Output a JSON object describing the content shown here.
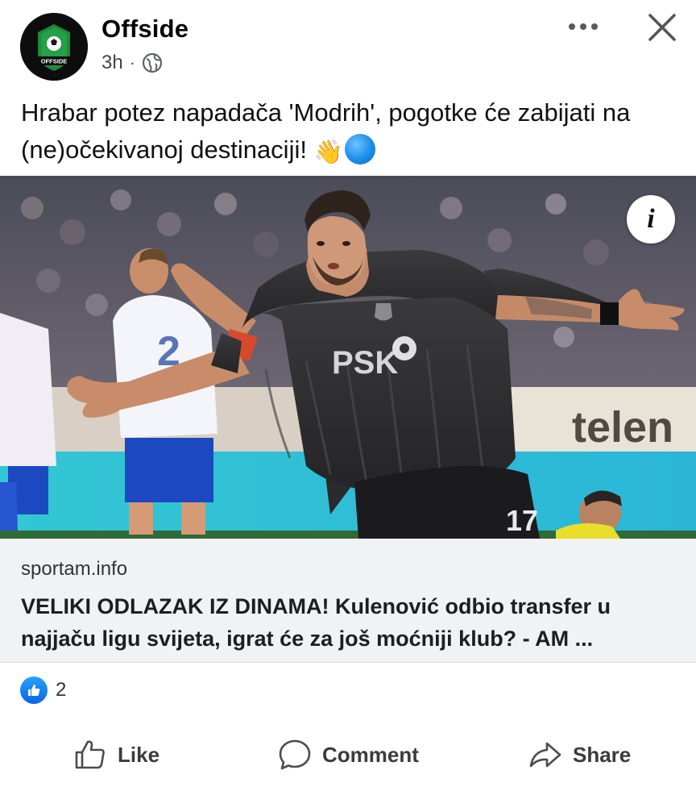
{
  "post": {
    "page_name": "Offside",
    "avatar_logo_text": "OFFSIDE",
    "time": "3h",
    "separator": "·",
    "audience_icon": "globe-icon",
    "caption": "Hrabar potez napadača 'Modrih', pogotke će zabijati na (ne)očekivanoj destinaciji!",
    "caption_emoji": "👋",
    "caption_emoji_2": "blue-circle"
  },
  "photo": {
    "info_label": "i",
    "jersey_sponsor": "PSK",
    "jersey_number": "17",
    "board_text": "telen"
  },
  "link": {
    "domain": "sportam.info",
    "title": "VELIKI ODLAZAK IZ DINAMA! Kulenović odbio transfer u najjaču ligu svijeta, igrat će za još moćniji klub? - AM ..."
  },
  "reactions": {
    "count": "2",
    "icon": "like-reaction-icon"
  },
  "actions": {
    "like": "Like",
    "comment": "Comment",
    "share": "Share"
  },
  "colors": {
    "accent": "#0866FF",
    "link_bg": "#F0F2F5",
    "avatar_green": "#1e8a3a"
  }
}
